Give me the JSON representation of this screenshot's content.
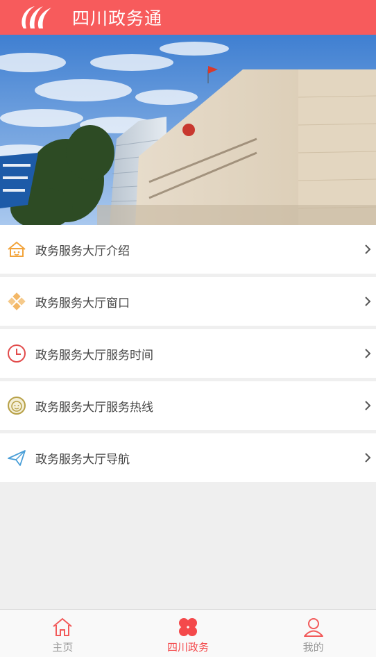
{
  "header": {
    "title": "四川政务通",
    "logo_icon": "swirl-logo-icon"
  },
  "banner": {
    "alt": "",
    "sky_color": "#5c92d8",
    "wall_color": "#e9dfcf"
  },
  "menu": {
    "items": [
      {
        "label": "政务服务大厅介绍",
        "icon": "house-icon",
        "color": "#f2a33a"
      },
      {
        "label": "政务服务大厅窗口",
        "icon": "diamond-grid-icon",
        "color": "#f3b766"
      },
      {
        "label": "政务服务大厅服务时间",
        "icon": "clock-icon",
        "color": "#e24b4b"
      },
      {
        "label": "政务服务大厅服务热线",
        "icon": "smiley-icon",
        "color": "#b7a046"
      },
      {
        "label": "政务服务大厅导航",
        "icon": "paper-plane-icon",
        "color": "#4a9fd8"
      }
    ]
  },
  "tabbar": {
    "tabs": [
      {
        "label": "主页",
        "icon": "home-icon",
        "active": false
      },
      {
        "label": "四川政务",
        "icon": "clover-icon",
        "active": true
      },
      {
        "label": "我的",
        "icon": "user-icon",
        "active": false
      }
    ],
    "active_color": "#f4494b",
    "inactive_color": "#999999"
  }
}
